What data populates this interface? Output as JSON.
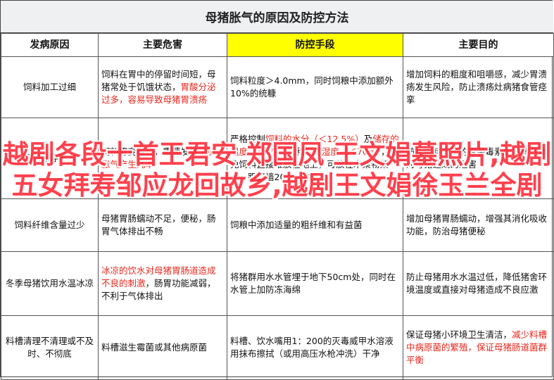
{
  "title": "母猪胀气的原因及防控方法",
  "headers": [
    "发病原因",
    "主要危害",
    "防控手段",
    "主要目的"
  ],
  "colors": {
    "highlight": "#ffff00",
    "red_text": "#e8281e",
    "overlay_text": "#ff3340"
  },
  "rows": [
    {
      "cause": "饲料加工过细",
      "harm": [
        {
          "t": "饲料在胃中的停留时间短，母猪常处于饥饿状态，"
        },
        {
          "t": "胃酸分泌过多，容易导致母猪胃溃疡",
          "red": true
        }
      ],
      "control": [
        {
          "t": "饲料粒度＞4.0mm，同时饲粮中添加额外10%的统糠"
        }
      ],
      "purpose": [
        {
          "t": "增加饲料的粗度和咀嚼感，减少胃溃疡发生风险，防止溃疡灶病猪食管痉挛"
        }
      ]
    },
    {
      "cause": "饲料保存不当",
      "harm": [
        {
          "t": "饲料霉变酸败，霉菌发酵"
        },
        {
          "t": "增加胀气产生几率",
          "red": true
        }
      ],
      "control": [
        {
          "t": "严格控制"
        },
        {
          "t": "饲料的水分（＜12.5%）",
          "red": true
        },
        {
          "t": "及"
        },
        {
          "t": "储存的温度（＜15℃）",
          "red": true
        },
        {
          "t": "和"
        },
        {
          "t": "相对湿度（＜70%）",
          "red": true
        },
        {
          "t": "，避免饲料直接堆放在地上，可放在木架物架上，距离墙20cm左右"
        }
      ],
      "purpose": [
        {
          "t": "防止饲料产生的霉菌毒素或发酵气体对母猪造成的危害"
        }
      ]
    },
    {
      "cause": "饲料纤维含量过少",
      "harm": [
        {
          "t": "母猪胃肠蠕动不足，便秘，肠胃气体排出不畅"
        }
      ],
      "control": [
        {
          "t": "饲粮中添加适量的粗纤维和有益菌"
        }
      ],
      "purpose": [
        {
          "t": "增加母猪胃肠蠕动，增强其消化吸收功能，防治母猪便秘"
        }
      ]
    },
    {
      "cause": "冬季母猪饮用水温冰凉",
      "harm": [
        {
          "t": "冰凉的饮水对母猪胃肠道造成不良的刺激",
          "red": true
        },
        {
          "t": "，肠胃功能减弱，不利于气体排出"
        }
      ],
      "control": [
        {
          "t": "将猪群用水水管埋于地下50cm处，同时在水管上加防冻海绵"
        }
      ],
      "purpose": [
        {
          "t": "防止母猪用水水温过低，降低猪舍环境温度或直接对母猪造成不良应激"
        }
      ]
    },
    {
      "cause": "料槽清理不清理或不及时、不彻底",
      "harm": [
        {
          "t": "料槽滋生霉菌或其他病原菌"
        }
      ],
      "control": [
        {
          "t": "料槽、饮水嘴用1：200的灭毒威甲水溶液用抹布擦拭（或用高压水枪冲洗）干净"
        }
      ],
      "purpose": [
        {
          "t": "保证母猪小环境卫生清洁，"
        },
        {
          "t": "减少料槽中病原菌的繁殖，保证母猪肠道菌群平衡",
          "red": true
        }
      ]
    }
  ],
  "overlay": "越剧各段十首王君安 郑国凤 王文娟墓照片,越剧五女拜寿邹应龙回故乡,越剧王文娟徐玉兰全剧"
}
